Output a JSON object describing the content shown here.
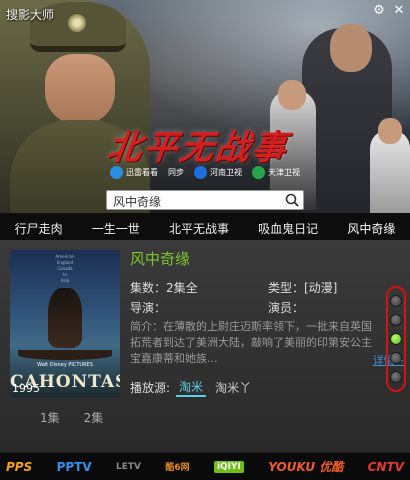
{
  "app": {
    "title": "搜影大师"
  },
  "window_controls": [
    {
      "icon": "gear-icon",
      "glyph": "⚙"
    },
    {
      "icon": "close-icon",
      "glyph": "✕"
    }
  ],
  "banner": {
    "show_title": "北平无战事",
    "partners": [
      {
        "name": "迅雷看看",
        "color": "#2a8fe0"
      },
      {
        "name": "同步",
        "color": "#1d6fe0"
      },
      {
        "name": "河南卫视",
        "color": "#1d6fe0"
      },
      {
        "name": "天津卫视",
        "color": "#25a64a"
      }
    ]
  },
  "search": {
    "value": "风中奇缘",
    "icon": "search-icon"
  },
  "tabs": [
    {
      "label": "行尸走肉"
    },
    {
      "label": "一生一世"
    },
    {
      "label": "北平无战事"
    },
    {
      "label": "吸血鬼日记"
    },
    {
      "label": "风中奇缘"
    }
  ],
  "detail": {
    "title": "风中奇缘",
    "episodes_info": "集数：2集全",
    "type_info": "类型：[动漫]",
    "director_info": "导演：",
    "cast_info": "演员：",
    "summary": "简介：在薄散的上尉庄迈斯率领下，一批来自英国拓荒者到达了美洲大陆，敲响了美丽的印第安公主宝嘉康蒂和她族...",
    "more_link": "详情>",
    "poster": {
      "credits": "American\nEngland\nCanada\nIn\nAsia",
      "studio": "Walt Disney PICTURES",
      "title": "CAHONTAS",
      "year": "1995"
    },
    "source_label": "播放源:",
    "sources": [
      {
        "label": "淘米",
        "active": true
      },
      {
        "label": "淘米丫",
        "active": false
      }
    ],
    "episodes": [
      {
        "label": "1集"
      },
      {
        "label": "2集"
      }
    ]
  },
  "pagination": {
    "count": 5,
    "active_index": 2
  },
  "footer_logos": [
    {
      "label": "PPS",
      "class": "pps"
    },
    {
      "label": "PPTV",
      "class": "pptv"
    },
    {
      "label": "LETV",
      "class": "letv"
    },
    {
      "label": "酷6网",
      "class": "ku6"
    },
    {
      "label": "iQIYI",
      "class": "iqiyi"
    },
    {
      "label": "YOUKU 优酷",
      "class": "youku"
    },
    {
      "label": "CNTV",
      "class": "cntv"
    }
  ]
}
